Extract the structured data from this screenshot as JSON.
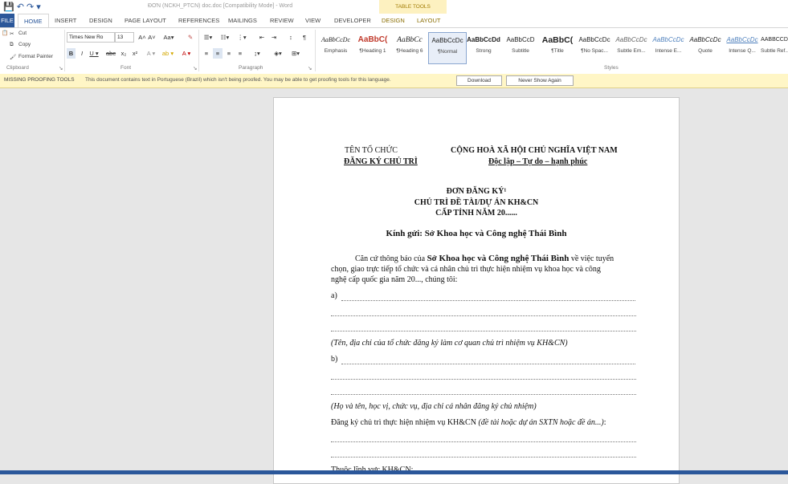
{
  "titlebar": {
    "quick_access": "💾 ↶ ↷ ▾",
    "doc_title": "ĐƠN (NCKH_PTCN) doc.doc [Compatibility Mode] - Word",
    "context_tab": "TABLE TOOLS"
  },
  "ribbon_tabs": [
    "FILE",
    "HOME",
    "INSERT",
    "DESIGN",
    "PAGE LAYOUT",
    "REFERENCES",
    "MAILINGS",
    "REVIEW",
    "VIEW",
    "DEVELOPER",
    "DESIGN",
    "LAYOUT"
  ],
  "clipboard": {
    "cut": "Cut",
    "copy": "Copy",
    "format_painter": "Format Painter",
    "label": "Clipboard"
  },
  "font": {
    "name": "Times New Ro",
    "size": "13",
    "label": "Font"
  },
  "paragraph": {
    "label": "Paragraph"
  },
  "styles": {
    "label": "Styles",
    "items": [
      {
        "preview": "AaBbCcDc",
        "name": "Emphasis"
      },
      {
        "preview": "AaBbC(",
        "name": "¶Heading 1"
      },
      {
        "preview": "AaBbCc",
        "name": "¶Heading 6"
      },
      {
        "preview": "AaBbCcDc",
        "name": "¶Normal"
      },
      {
        "preview": "AaBbCcDd",
        "name": "Strong"
      },
      {
        "preview": "AaBbCcD",
        "name": "Subtitle"
      },
      {
        "preview": "AaBbC(",
        "name": "¶Title"
      },
      {
        "preview": "AaBbCcDc",
        "name": "¶No Spac..."
      },
      {
        "preview": "AaBbCcDc",
        "name": "Subtle Em..."
      },
      {
        "preview": "AaBbCcDc",
        "name": "Intense E..."
      },
      {
        "preview": "AaBbCcDc",
        "name": "Quote"
      },
      {
        "preview": "AaBbCcDc",
        "name": "Intense Q..."
      },
      {
        "preview": "AABBCCD",
        "name": "Subtle Ref..."
      }
    ]
  },
  "message_bar": {
    "label": "MISSING PROOFING TOOLS",
    "text": "This document contains text in Portuguese (Brazil) which isn't being proofed. You may be able to get proofing tools for this language.",
    "download": "Download",
    "never_show": "Never Show Again"
  },
  "document": {
    "org_line1": "TÊN TỔ CHỨC",
    "org_line2": "ĐĂNG KÝ CHỦ TRÌ",
    "nation_line1": "CỘNG HOÀ XÃ HỘI CHỦ NGHĨA VIỆT NAM",
    "nation_line2": "Độc lập – Tự do – hạnh phúc",
    "form_title": "ĐƠN ĐĂNG KÝ¹",
    "form_sub1": "CHỦ TRÌ ĐỀ TÀI/DỰ ÁN KH&CN",
    "form_sub2": "CẤP TỈNH NĂM 20......",
    "addressee": "Kính gửi: Sở Khoa học và Công nghệ Thái Bình",
    "para_start": "Căn cứ thông báo của ",
    "para_bold": "Sở Khoa học và Công nghệ Thái Bình",
    "para_end": " về việc tuyển",
    "para_line2": "chọn, giao trực tiếp tổ chức và cá nhân chủ trì thực hiện nhiệm vụ khoa học và công",
    "para_line3": "nghệ cấp quốc gia năm 20..., chúng tôi:",
    "item_a": "a)",
    "note_a": "(Tên, địa chỉ của tổ chức đăng ký làm cơ quan chủ trì nhiệm vụ KH&CN)",
    "item_b": "b)",
    "note_b": "(Họ và tên, học vị, chức vụ, địa chỉ cá nhân đăng ký chủ nhiệm)",
    "register_text": "Đăng ký chủ trì thực hiện nhiệm vụ KH&CN ",
    "register_italic": "(đề tài hoặc dự án SXTN hoặc đề án...)",
    "register_end": ":",
    "last_line": "Thuộc lĩnh vực KH&CN:"
  }
}
